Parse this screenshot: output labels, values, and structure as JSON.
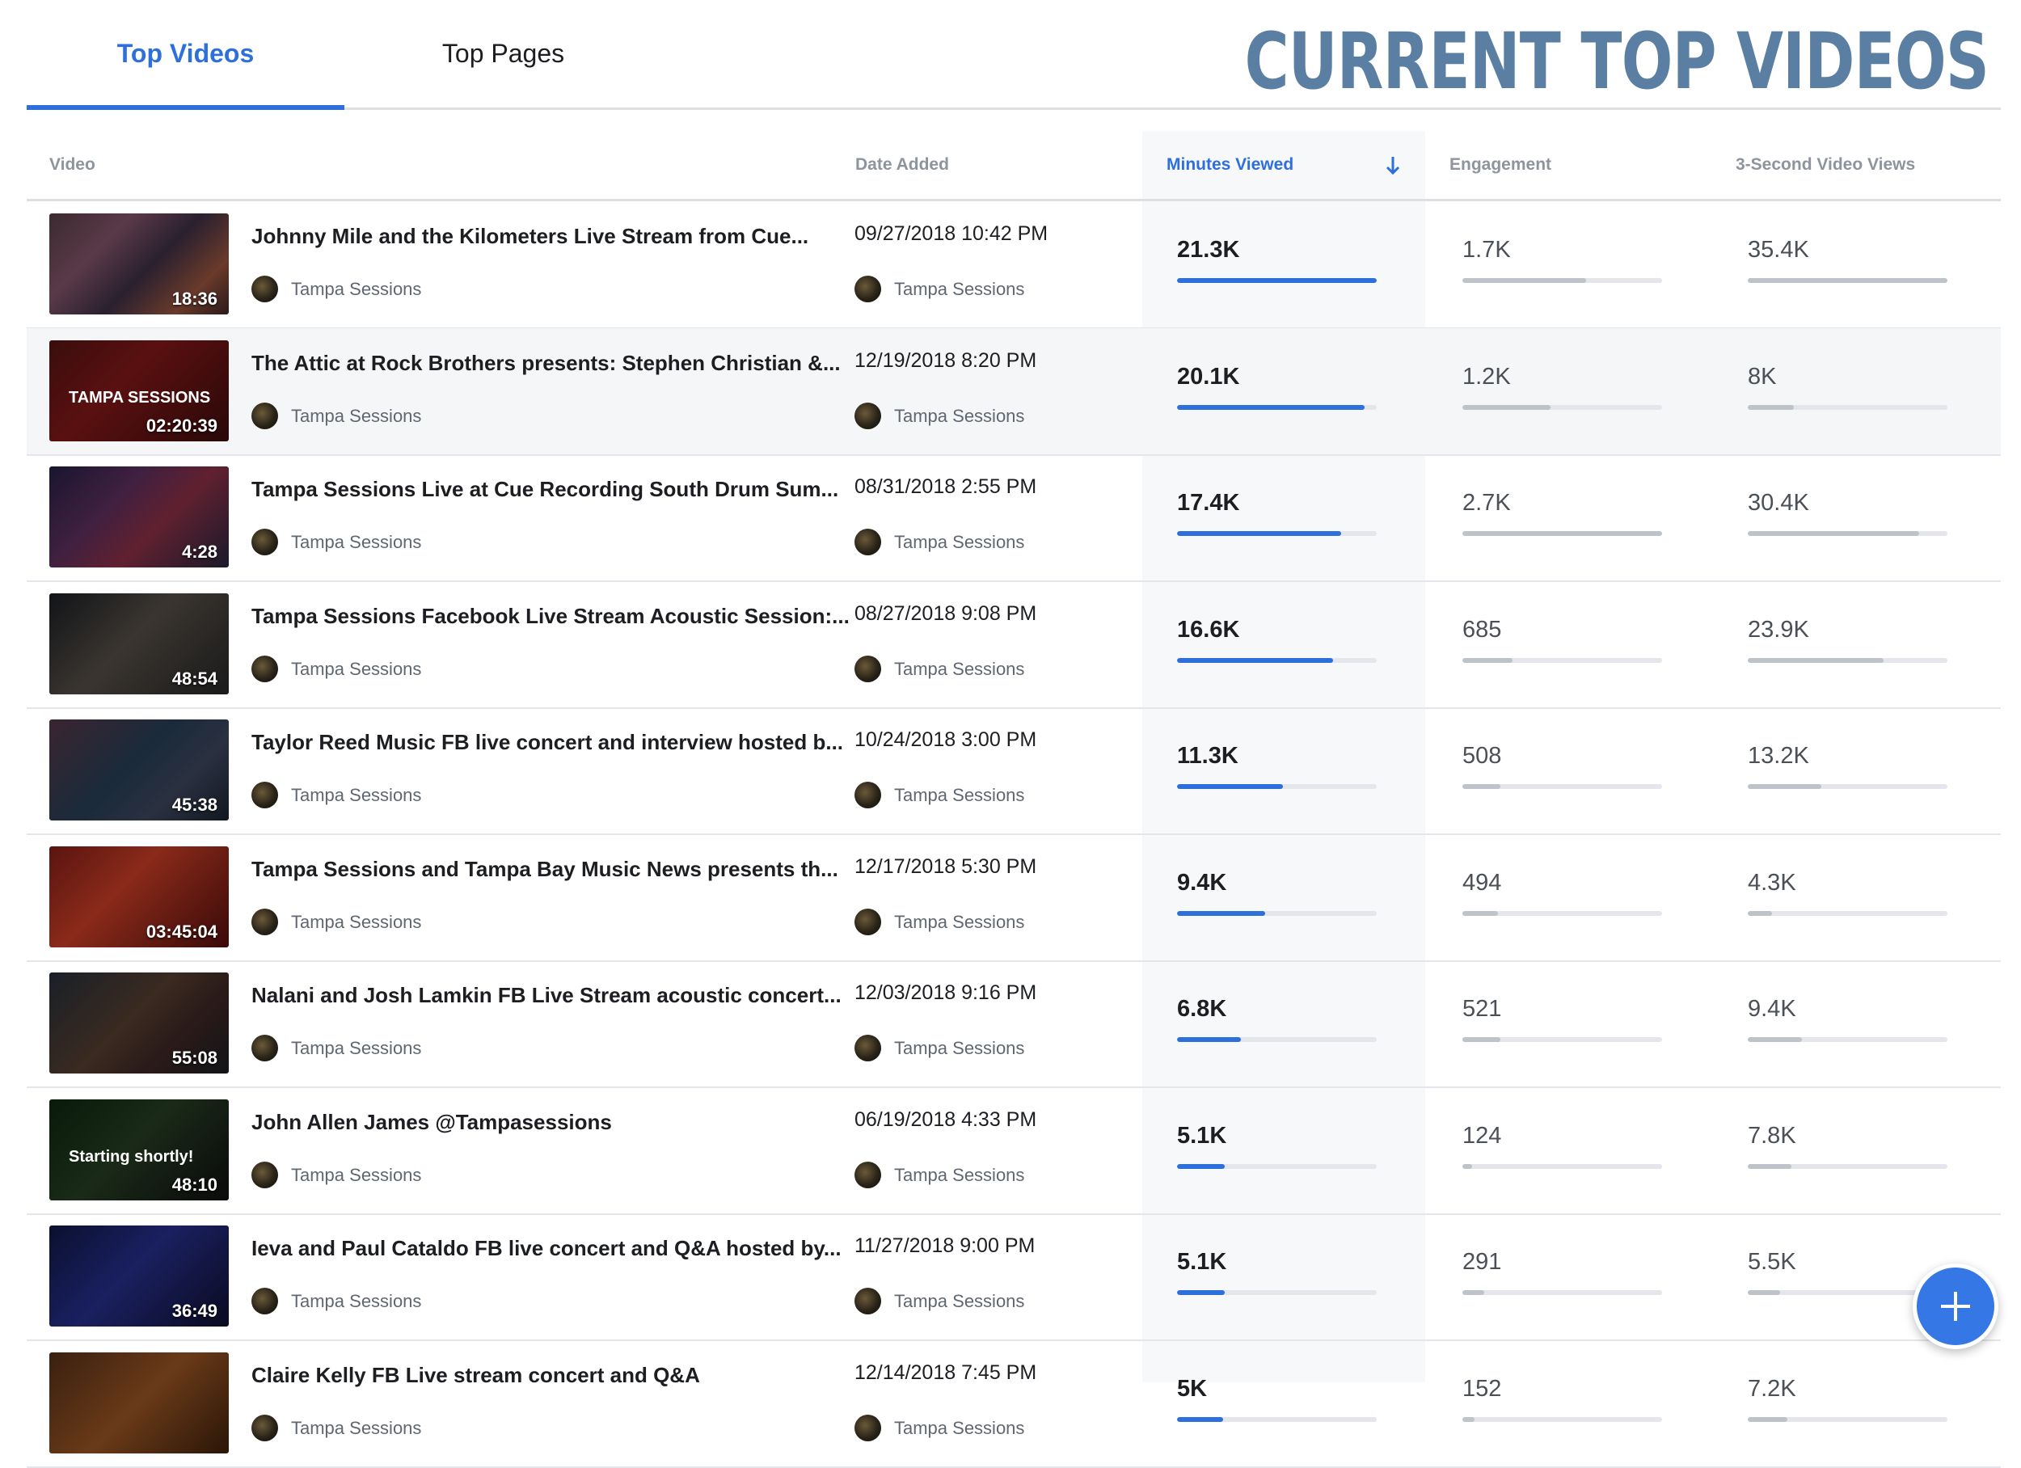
{
  "tabs": [
    {
      "label": "Top Videos",
      "active": true
    },
    {
      "label": "Top Pages",
      "active": false
    }
  ],
  "banner": "CURRENT TOP VIDEOS",
  "columns": {
    "video": "Video",
    "date": "Date Added",
    "minutes": "Minutes Viewed",
    "engagement": "Engagement",
    "views": "3-Second Video Views"
  },
  "colors": {
    "accent": "#2d6fdb",
    "bar_neutral": "#bec3c9",
    "bar_track": "#e4e6eb"
  },
  "rows": [
    {
      "title": "Johnny Mile and the Kilometers Live Stream from Cue...",
      "duration": "18:36",
      "page": "Tampa Sessions",
      "date": "09/27/2018 10:42 PM",
      "minutes": "21.3K",
      "minutes_fill": 1.0,
      "engagement": "1.7K",
      "engagement_fill": 0.62,
      "views": "35.4K",
      "views_fill": 1.0
    },
    {
      "title": "The Attic at Rock Brothers presents: Stephen Christian &...",
      "duration": "02:20:39",
      "thumb_text": "TAMPA SESSIONS",
      "page": "Tampa Sessions",
      "date": "12/19/2018 8:20 PM",
      "minutes": "20.1K",
      "minutes_fill": 0.94,
      "engagement": "1.2K",
      "engagement_fill": 0.44,
      "views": "8K",
      "views_fill": 0.23
    },
    {
      "title": "Tampa Sessions Live at Cue Recording South Drum Sum...",
      "duration": "4:28",
      "page": "Tampa Sessions",
      "date": "08/31/2018 2:55 PM",
      "minutes": "17.4K",
      "minutes_fill": 0.82,
      "engagement": "2.7K",
      "engagement_fill": 1.0,
      "views": "30.4K",
      "views_fill": 0.86
    },
    {
      "title": "Tampa Sessions Facebook Live Stream Acoustic Session:...",
      "duration": "48:54",
      "page": "Tampa Sessions",
      "date": "08/27/2018 9:08 PM",
      "minutes": "16.6K",
      "minutes_fill": 0.78,
      "engagement": "685",
      "engagement_fill": 0.25,
      "views": "23.9K",
      "views_fill": 0.68
    },
    {
      "title": "Taylor Reed Music FB live concert and interview hosted b...",
      "duration": "45:38",
      "page": "Tampa Sessions",
      "date": "10/24/2018 3:00 PM",
      "minutes": "11.3K",
      "minutes_fill": 0.53,
      "engagement": "508",
      "engagement_fill": 0.19,
      "views": "13.2K",
      "views_fill": 0.37
    },
    {
      "title": "Tampa Sessions and Tampa Bay Music News presents th...",
      "duration": "03:45:04",
      "page": "Tampa Sessions",
      "date": "12/17/2018 5:30 PM",
      "minutes": "9.4K",
      "minutes_fill": 0.44,
      "engagement": "494",
      "engagement_fill": 0.18,
      "views": "4.3K",
      "views_fill": 0.12
    },
    {
      "title": "Nalani and Josh Lamkin FB Live Stream acoustic concert...",
      "duration": "55:08",
      "page": "Tampa Sessions",
      "date": "12/03/2018 9:16 PM",
      "minutes": "6.8K",
      "minutes_fill": 0.32,
      "engagement": "521",
      "engagement_fill": 0.19,
      "views": "9.4K",
      "views_fill": 0.27
    },
    {
      "title": "John Allen James @Tampasessions",
      "duration": "48:10",
      "thumb_text": "Starting shortly!",
      "page": "Tampa Sessions",
      "date": "06/19/2018 4:33 PM",
      "minutes": "5.1K",
      "minutes_fill": 0.24,
      "engagement": "124",
      "engagement_fill": 0.05,
      "views": "7.8K",
      "views_fill": 0.22
    },
    {
      "title": "Ieva and Paul Cataldo FB live concert and Q&A hosted by...",
      "duration": "36:49",
      "page": "Tampa Sessions",
      "date": "11/27/2018 9:00 PM",
      "minutes": "5.1K",
      "minutes_fill": 0.24,
      "engagement": "291",
      "engagement_fill": 0.11,
      "views": "5.5K",
      "views_fill": 0.16
    },
    {
      "title": "Claire Kelly FB Live stream concert and Q&A",
      "duration": "",
      "page": "Tampa Sessions",
      "date": "12/14/2018 7:45 PM",
      "minutes": "5K",
      "minutes_fill": 0.23,
      "engagement": "152",
      "engagement_fill": 0.06,
      "views": "7.2K",
      "views_fill": 0.2
    }
  ],
  "fab_icon": "plus-icon"
}
